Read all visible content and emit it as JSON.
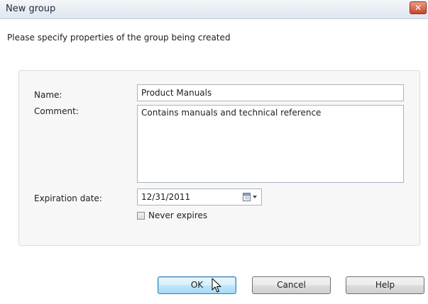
{
  "window": {
    "title": "New group",
    "close_glyph": "✕"
  },
  "subtitle": "Please specify properties of the group being created",
  "form": {
    "name_label": "Name:",
    "name_value": "Product Manuals",
    "comment_label": "Comment:",
    "comment_value": "Contains manuals and technical reference",
    "expiration_label": "Expiration date:",
    "expiration_value": "12/31/2011",
    "never_expires_label": "Never expires",
    "never_expires_checked": false
  },
  "buttons": {
    "ok": "OK",
    "cancel": "Cancel",
    "help": "Help"
  },
  "icons": {
    "close": "close-icon",
    "calendar": "calendar-icon",
    "dropdown": "chevron-down-icon",
    "cursor": "mouse-pointer-icon"
  },
  "colors": {
    "close_button": "#c9472e",
    "default_button_border": "#3c7fb1",
    "panel_background": "#f7f7f8"
  }
}
